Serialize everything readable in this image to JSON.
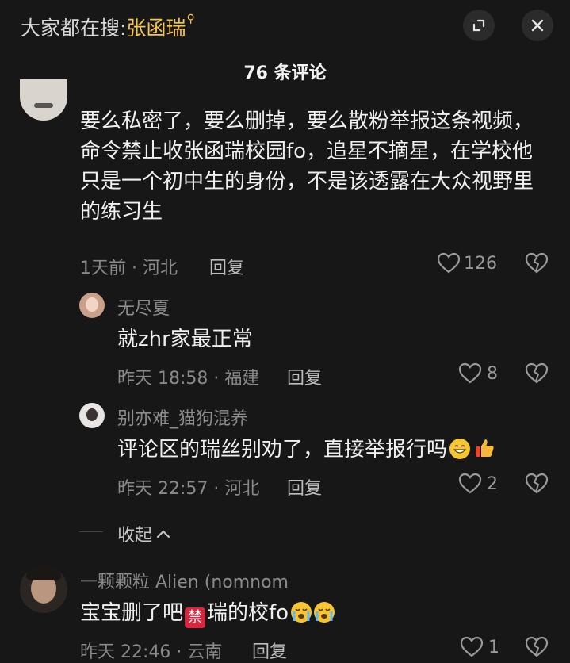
{
  "header": {
    "search_prefix": "大家都在搜:",
    "search_keyword": "张函瑞",
    "comments_title": "76 条评论"
  },
  "comments": [
    {
      "body": "要么私密了，要么删掉，要么散粉举报这条视频，命令禁止收张函瑞校园fo，追星不摘星，在学校他只是一个初中生的身份，不是该透露在大众视野里的练习生",
      "meta": "1天前 · 河北",
      "reply_label": "回复",
      "likes": "126"
    },
    {
      "username": "无尽夏",
      "body": "就zhr家最正常",
      "meta": "昨天 18:58 · 福建",
      "reply_label": "回复",
      "likes": "8"
    },
    {
      "username": "别亦难_猫狗混养",
      "body": "评论区的瑞丝别劝了，直接举报行吗",
      "meta": "昨天 22:57 · 河北",
      "reply_label": "回复",
      "likes": "2"
    },
    {
      "username": "一颗颗粒 Alien (nomnom",
      "body_prefix": "宝宝删了吧",
      "body_ban": "禁",
      "body_suffix": "瑞的校fo",
      "meta": "昨天 22:46 · 云南",
      "reply_label": "回复",
      "likes": "1"
    }
  ],
  "collapse_label": "收起",
  "colors": {
    "background": "#171717",
    "keyword": "#f4c64e",
    "meta_gray": "#8a8a8a"
  }
}
